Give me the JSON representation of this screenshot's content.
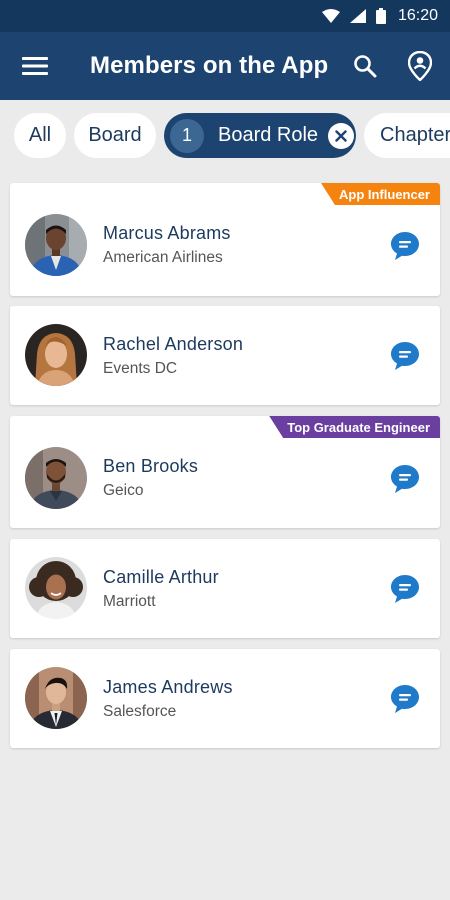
{
  "status_bar": {
    "time": "16:20",
    "icons": [
      "wifi-icon",
      "signal-icon",
      "battery-icon"
    ]
  },
  "app_bar": {
    "title": "Members on the App",
    "menu_icon": "menu-icon",
    "search_icon": "search-icon",
    "location_icon": "location-pin-icon"
  },
  "filters": {
    "chips": [
      {
        "label": "All",
        "active": false
      },
      {
        "label": "Board",
        "active": false
      },
      {
        "label": "Board Role",
        "active": true,
        "count": "1"
      },
      {
        "label": "Chapter",
        "active": false
      }
    ]
  },
  "members": [
    {
      "name": "Marcus Abrams",
      "company": "American Airlines",
      "badge": "App Influencer",
      "badge_color": "#f5830f"
    },
    {
      "name": "Rachel Anderson",
      "company": "Events DC"
    },
    {
      "name": "Ben Brooks",
      "company": "Geico",
      "badge": "Top Graduate Engineer",
      "badge_color": "#6a3fa0"
    },
    {
      "name": "Camille Arthur",
      "company": "Marriott"
    },
    {
      "name": "James Andrews",
      "company": "Salesforce"
    }
  ],
  "colors": {
    "header": "#1d4470",
    "status_bar": "#14375e",
    "accent_blue": "#1f7ac9",
    "background": "#ebebeb"
  }
}
